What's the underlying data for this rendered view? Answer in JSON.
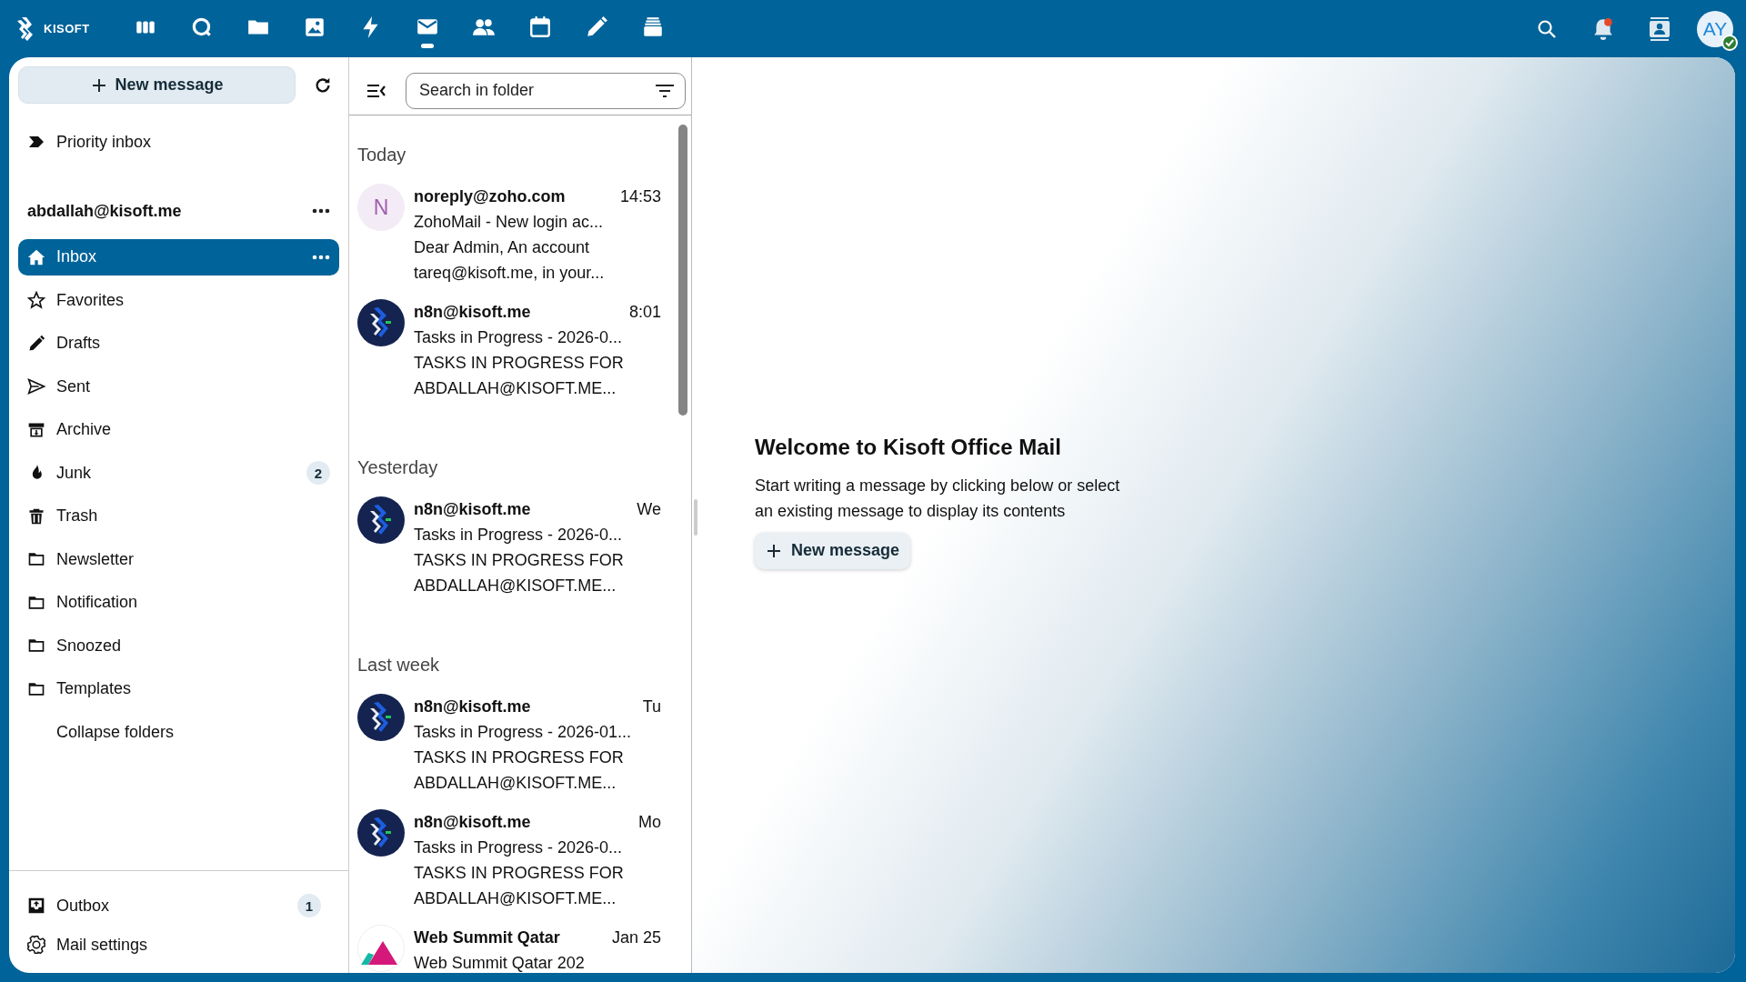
{
  "topbar": {
    "logo": "KISOFT",
    "apps": [
      {
        "selected": false
      },
      {
        "selected": false
      },
      {
        "selected": false
      },
      {
        "selected": false
      },
      {
        "selected": false
      },
      {
        "selected": true
      },
      {
        "selected": false
      },
      {
        "selected": false
      },
      {
        "selected": false
      },
      {
        "selected": false
      }
    ],
    "notification_dot": true,
    "avatar": {
      "initials": "AY",
      "online": true
    }
  },
  "sidebar": {
    "new_message": "New message",
    "priority": "Priority inbox",
    "account": "abdallah@kisoft.me",
    "folders": [
      {
        "label": "Inbox",
        "selected": true
      },
      {
        "label": "Favorites",
        "selected": false
      },
      {
        "label": "Drafts",
        "selected": false
      },
      {
        "label": "Sent",
        "selected": false
      },
      {
        "label": "Archive",
        "selected": false
      },
      {
        "label": "Junk",
        "selected": false,
        "count": "2"
      },
      {
        "label": "Trash",
        "selected": false
      },
      {
        "label": "Newsletter",
        "selected": false
      },
      {
        "label": "Notification",
        "selected": false
      },
      {
        "label": "Snoozed",
        "selected": false
      },
      {
        "label": "Templates",
        "selected": false
      }
    ],
    "collapse": "Collapse folders",
    "outbox": {
      "label": "Outbox",
      "count": "1"
    },
    "settings": "Mail settings"
  },
  "list": {
    "search_placeholder": "Search in folder",
    "groups": [
      {
        "heading": "Today",
        "messages": [
          {
            "kind": "letter",
            "initial": "N",
            "from": "noreply@zoho.com",
            "time": "14:53",
            "subject": "ZohoMail - New login ac...",
            "preview": [
              "Dear Admin, An account",
              "tareq@kisoft.me, in your..."
            ]
          },
          {
            "kind": "logo",
            "from": "n8n@kisoft.me",
            "time": "8:01",
            "subject": "Tasks in Progress - 2026-0...",
            "preview": [
              "TASKS IN PROGRESS FOR",
              "ABDALLAH@KISOFT.ME..."
            ]
          }
        ]
      },
      {
        "heading": "Yesterday",
        "messages": [
          {
            "kind": "logo",
            "from": "n8n@kisoft.me",
            "time": "We",
            "subject": "Tasks in Progress - 2026-0...",
            "preview": [
              "TASKS IN PROGRESS FOR",
              "ABDALLAH@KISOFT.ME..."
            ]
          }
        ]
      },
      {
        "heading": "Last week",
        "messages": [
          {
            "kind": "logo",
            "from": "n8n@kisoft.me",
            "time": "Tu",
            "subject": "Tasks in Progress - 2026-01...",
            "preview": [
              "TASKS IN PROGRESS FOR",
              "ABDALLAH@KISOFT.ME..."
            ]
          },
          {
            "kind": "logo",
            "from": "n8n@kisoft.me",
            "time": "Mo",
            "subject": "Tasks in Progress - 2026-0...",
            "preview": [
              "TASKS IN PROGRESS FOR",
              "ABDALLAH@KISOFT.ME..."
            ]
          },
          {
            "kind": "peaks",
            "from": "Web Summit Qatar",
            "time": "Jan 25",
            "subject": "Web Summit Qatar 202"
          }
        ]
      }
    ]
  },
  "welcome": {
    "title": "Welcome to Kisoft Office Mail",
    "text": "Start writing a message by clicking below or select an existing message to display its contents",
    "button": "New message"
  }
}
